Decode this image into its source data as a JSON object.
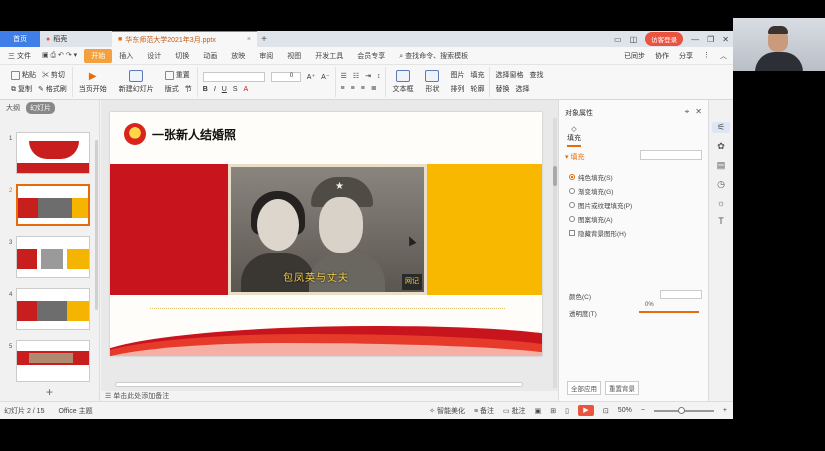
{
  "tabbar": {
    "home": "首页",
    "wps": "稻壳",
    "doc_title": "华东师范大学2021年3月.pptx",
    "login": "访客登录"
  },
  "menu": {
    "file": "三 文件",
    "items": [
      "开始",
      "插入",
      "设计",
      "切换",
      "动画",
      "放映",
      "审阅",
      "视图",
      "开发工具",
      "会员专享"
    ],
    "active": "开始",
    "search": "查找命令、搜索模板",
    "right": [
      "已同步",
      "协作",
      "分享"
    ]
  },
  "ribbon": {
    "paste": "粘贴",
    "cut": "剪切",
    "copy": "复制",
    "format_painter": "格式刷",
    "current_slide": "当页开始",
    "new_slide": "新建幻灯片",
    "layout": "版式",
    "section": "节",
    "reset": "重置",
    "font_size": "0",
    "textbox": "文本框",
    "shape": "形状",
    "arrange": "排列",
    "picture": "图片",
    "find": "查找",
    "replace": "替换",
    "select": "选择",
    "fill": "填充",
    "outline": "轮廓",
    "select_pane": "选择窗格"
  },
  "leftpanel": {
    "tab_outline": "大纲",
    "tab_slides": "幻灯片",
    "slide_numbers": [
      "1",
      "2",
      "3",
      "4",
      "5"
    ]
  },
  "slide": {
    "title": "一张新人结婚照",
    "caption": "包凤英与丈夫",
    "stamp": "网记"
  },
  "notes": {
    "placeholder": "单击此处添加备注"
  },
  "rightpanel": {
    "title": "对象属性",
    "tab_fill": "填充",
    "section_fill": "填充",
    "options": [
      "纯色填充(S)",
      "渐变填充(G)",
      "图片或纹理填充(P)",
      "图案填充(A)"
    ],
    "checkbox": "隐藏背景图形(H)",
    "color_label": "颜色(C)",
    "transparency_label": "透明度(T)",
    "transparency_value": "0%",
    "apply_all": "全部应用",
    "reset_bg": "重置背景"
  },
  "statusbar": {
    "slide_info": "幻灯片 2 / 15",
    "theme": "Office 主题",
    "smart_beautify": "智能美化",
    "notes_btn": "备注",
    "comments_btn": "批注",
    "zoom": "50%"
  },
  "colors": {
    "accent": "#e46c0a",
    "brand_red": "#c8141c",
    "brand_yellow": "#f9b800"
  }
}
